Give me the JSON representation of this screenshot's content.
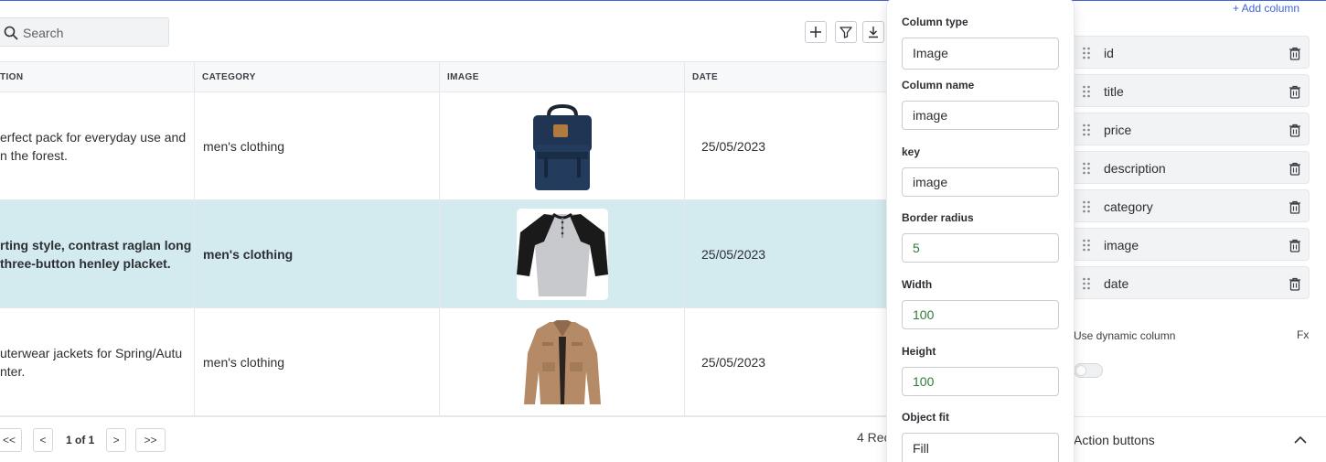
{
  "toolbar": {
    "search_placeholder": "Search",
    "add_icon": "plus-icon",
    "filter_icon": "filter-icon",
    "download_icon": "download-icon"
  },
  "table": {
    "headers": [
      "TION",
      "CATEGORY",
      "IMAGE",
      "DATE"
    ],
    "rows": [
      {
        "desc_line1": "erfect pack for everyday use and",
        "desc_line2": "n the forest.",
        "category": "men's clothing",
        "image": "backpack-image",
        "date": "25/05/2023",
        "selected": false
      },
      {
        "desc_line1": "rting style, contrast raglan long",
        "desc_line2": "three-button henley placket.",
        "category": "men's clothing",
        "image": "henley-shirt-image",
        "date": "25/05/2023",
        "selected": true
      },
      {
        "desc_line1": "uterwear jackets for Spring/Autu",
        "desc_line2": "nter.",
        "category": "men's clothing",
        "image": "jacket-image",
        "date": "25/05/2023",
        "selected": false
      }
    ],
    "selected_row_color": "#d3ebef"
  },
  "pagination": {
    "first": "<<",
    "prev": "<",
    "info": "1 of 1",
    "next": ">",
    "last": ">>",
    "records": "4 Rec"
  },
  "popover": {
    "fields": [
      {
        "label": "Column type",
        "value": "Image"
      },
      {
        "label": "Column name",
        "value": "image"
      },
      {
        "label": "key",
        "value": "image"
      },
      {
        "label": "Border radius",
        "value": "5"
      },
      {
        "label": "Width",
        "value": "100"
      },
      {
        "label": "Height",
        "value": "100"
      },
      {
        "label": "Object fit",
        "value": "Fill"
      }
    ]
  },
  "columns_panel": {
    "add_column": "+ Add column",
    "columns": [
      "id",
      "title",
      "price",
      "description",
      "category",
      "image",
      "date"
    ],
    "dynamic_label": "Use dynamic column",
    "fx_label": "Fx",
    "dynamic_enabled": false,
    "action_buttons_label": "Action buttons"
  },
  "colors": {
    "accent": "#3e63dd",
    "numeric_value": "#2f7a34"
  }
}
